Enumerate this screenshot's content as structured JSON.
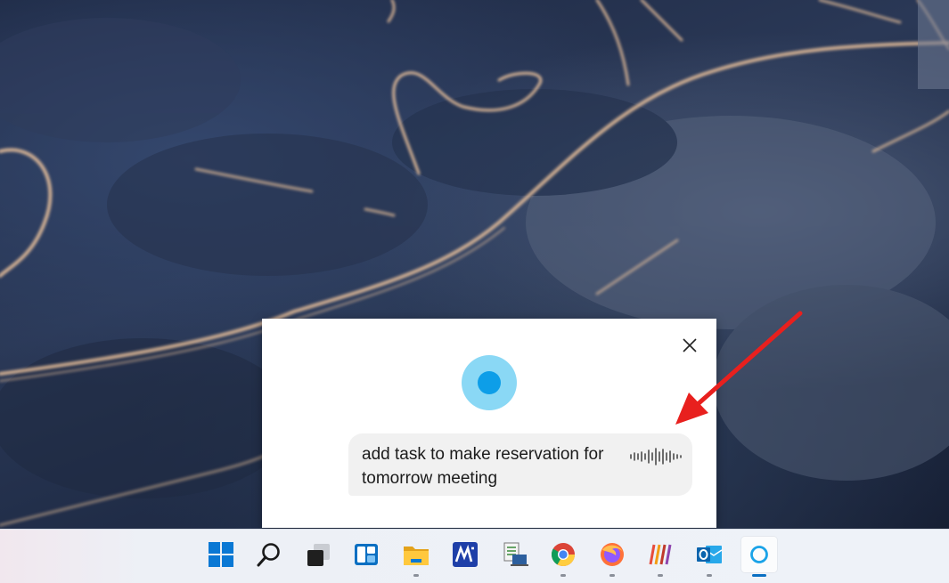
{
  "cortana": {
    "spoken_text": "add task to make reservation for tomorrow meeting",
    "accent_color": "#0d9ee8",
    "orb_halo_color": "#8ad8f5"
  },
  "annotation": {
    "arrow_color": "#e8201e"
  },
  "taskbar": {
    "items": [
      {
        "name": "start-button",
        "icon": "windows-logo-icon",
        "running": false
      },
      {
        "name": "search-button",
        "icon": "search-icon",
        "running": false
      },
      {
        "name": "task-view-button",
        "icon": "task-view-icon",
        "running": false
      },
      {
        "name": "widgets-button",
        "icon": "widgets-icon",
        "running": false
      },
      {
        "name": "file-explorer-button",
        "icon": "folder-icon",
        "running": true
      },
      {
        "name": "app-button",
        "icon": "ma-app-icon",
        "running": false
      },
      {
        "name": "remote-desktop-button",
        "icon": "remote-desktop-icon",
        "running": false
      },
      {
        "name": "chrome-button",
        "icon": "chrome-icon",
        "running": true
      },
      {
        "name": "firefox-button",
        "icon": "firefox-icon",
        "running": true
      },
      {
        "name": "app-stripes-button",
        "icon": "stripes-app-icon",
        "running": true
      },
      {
        "name": "outlook-button",
        "icon": "outlook-icon",
        "running": true
      },
      {
        "name": "cortana-button",
        "icon": "cortana-icon",
        "running": true,
        "active": true
      }
    ]
  }
}
